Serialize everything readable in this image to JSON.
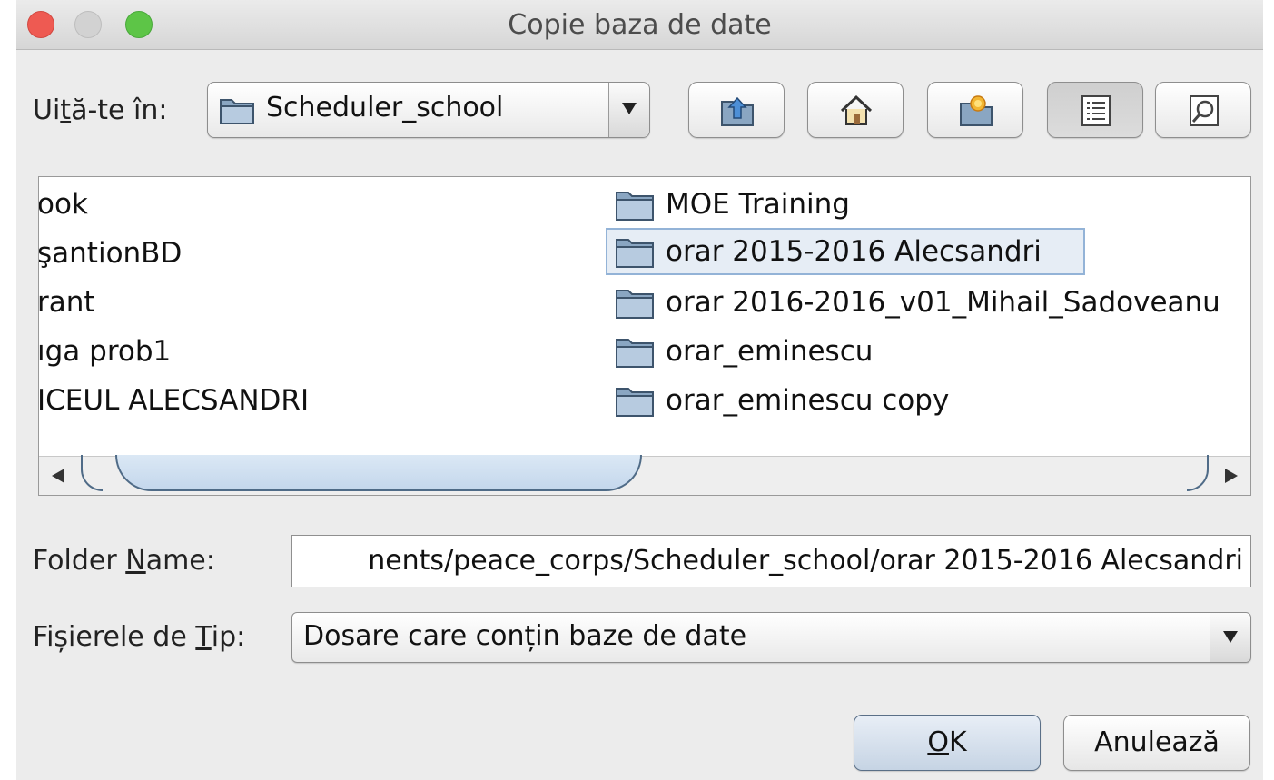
{
  "window": {
    "title": "Copie baza de date"
  },
  "look_in": {
    "label_pre": "Ui",
    "label_mnemonic": "t",
    "label_post": "ă-te în:",
    "value": "Scheduler_school"
  },
  "toolbar": {
    "icons": [
      "up-folder-icon",
      "home-icon",
      "new-folder-icon",
      "list-view-icon",
      "details-view-icon"
    ]
  },
  "file_list": {
    "left_column": [
      "ook",
      "şantionBD",
      "rant",
      "ıga prob1",
      "ICEUL ALECSANDRI"
    ],
    "right_column": [
      "MOE Training",
      "orar 2015-2016 Alecsandri",
      "orar 2016-2016_v01_Mihail_Sadoveanu",
      "orar_eminescu",
      "orar_eminescu copy"
    ],
    "selected": "orar 2015-2016 Alecsandri"
  },
  "folder_name": {
    "label_pre": "Folder ",
    "label_mnemonic": "N",
    "label_post": "ame:",
    "value": "nents/peace_corps/Scheduler_school/orar 2015-2016 Alecsandri"
  },
  "file_type": {
    "label_pre": "Fișierele de ",
    "label_mnemonic": "T",
    "label_post": "ip:",
    "value": "Dosare care conțin baze de date"
  },
  "buttons": {
    "ok_mnemonic": "O",
    "ok_rest": "K",
    "cancel": "Anulează"
  },
  "colors": {
    "selection_border": "#93b3d7",
    "close": "#ee5a52",
    "zoom": "#5dc547",
    "scroll_thumb": "#c4d7ec"
  }
}
